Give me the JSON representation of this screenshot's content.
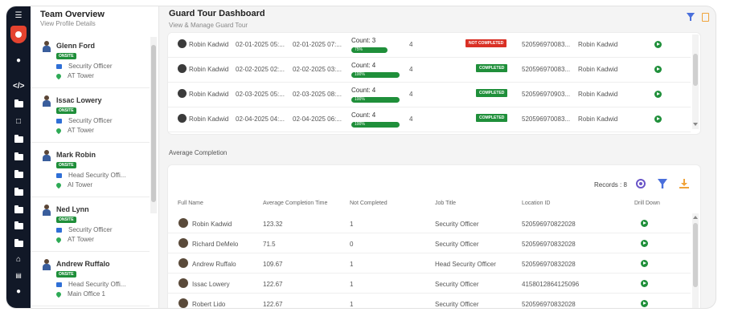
{
  "colors": {
    "accent_green": "#1f8f3a",
    "alert_red": "#d93025",
    "rail_bg": "#111827",
    "brand_red": "#e5432f",
    "link_blue": "#4a6fdc",
    "orange": "#f0a33a"
  },
  "rail": {
    "icons": [
      "menu-icon",
      "shield-logo-icon",
      "avatar-icon",
      "code-icon",
      "folder-icon",
      "monitor-icon",
      "folder-icon",
      "folder-icon",
      "folder-icon",
      "folder-icon",
      "folder-icon",
      "home-icon",
      "chart-icon",
      "person-icon"
    ]
  },
  "team": {
    "title": "Team Overview",
    "subtitle": "View Profile Details",
    "members": [
      {
        "name": "Glenn Ford",
        "status": "ONSITE",
        "role": "Security Officer",
        "location": "AT Tower"
      },
      {
        "name": "Issac Lowery",
        "status": "ONSITE",
        "role": "Security Officer",
        "location": "AT Tower"
      },
      {
        "name": "Mark Robin",
        "status": "ONSITE",
        "role": "Head Security Offi...",
        "location": "AI Tower"
      },
      {
        "name": "Ned Lynn",
        "status": "ONSITE",
        "role": "Security Officer",
        "location": "AT Tower"
      },
      {
        "name": "Andrew Ruffalo",
        "status": "ONSITE",
        "role": "Head Security Offi...",
        "location": "Main Office 1"
      }
    ]
  },
  "main": {
    "title": "Guard Tour Dashboard",
    "subtitle": "View & Manage Guard Tour"
  },
  "tours": [
    {
      "name": "Robin Kadwid",
      "start": "02-01-2025 05:...",
      "end": "02-01-2025 07:...",
      "count": "Count: 3",
      "bar": "75%",
      "progress": 0.75,
      "n": "4",
      "status": "NOT COMPLETED",
      "status_type": "red",
      "location": "520596970083...",
      "assignee": "Robin Kadwid"
    },
    {
      "name": "Robin Kadwid",
      "start": "02-02-2025 02:...",
      "end": "02-02-2025 03:...",
      "count": "Count: 4",
      "bar": "100%",
      "progress": 1.0,
      "n": "4",
      "status": "COMPLETED",
      "status_type": "green",
      "location": "520596970083...",
      "assignee": "Robin Kadwid"
    },
    {
      "name": "Robin Kadwid",
      "start": "02-03-2025 05:...",
      "end": "02-03-2025 08:...",
      "count": "Count: 4",
      "bar": "100%",
      "progress": 1.0,
      "n": "4",
      "status": "COMPLETED",
      "status_type": "green",
      "location": "520596970903...",
      "assignee": "Robin Kadwid"
    },
    {
      "name": "Robin Kadwid",
      "start": "02-04-2025 04:...",
      "end": "02-04-2025 06:...",
      "count": "Count: 4",
      "bar": "100%",
      "progress": 1.0,
      "n": "4",
      "status": "COMPLETED",
      "status_type": "green",
      "location": "520596970083...",
      "assignee": "Robin Kadwid"
    }
  ],
  "avg": {
    "title": "Average Completion",
    "records_label": "Records : 8",
    "headers": {
      "full_name": "Full Name",
      "avg_time": "Average Completion Time",
      "not_completed": "Not Completed",
      "job_title": "Job Title",
      "location_id": "Location ID",
      "drill_down": "Drill Down"
    },
    "rows": [
      {
        "name": "Robin Kadwid",
        "avg": "123.32",
        "nc": "1",
        "job": "Security Officer",
        "loc": "520596970822028"
      },
      {
        "name": "Richard DeMelo",
        "avg": "71.5",
        "nc": "0",
        "job": "Security Officer",
        "loc": "520596970832028"
      },
      {
        "name": "Andrew Ruffalo",
        "avg": "109.67",
        "nc": "1",
        "job": "Head Security Officer",
        "loc": "520596970832028"
      },
      {
        "name": "Issac Lowery",
        "avg": "122.67",
        "nc": "1",
        "job": "Security Officer",
        "loc": "4158012864125096"
      },
      {
        "name": "Robert Lido",
        "avg": "122.67",
        "nc": "1",
        "job": "Security Officer",
        "loc": "520596970832028"
      }
    ]
  }
}
